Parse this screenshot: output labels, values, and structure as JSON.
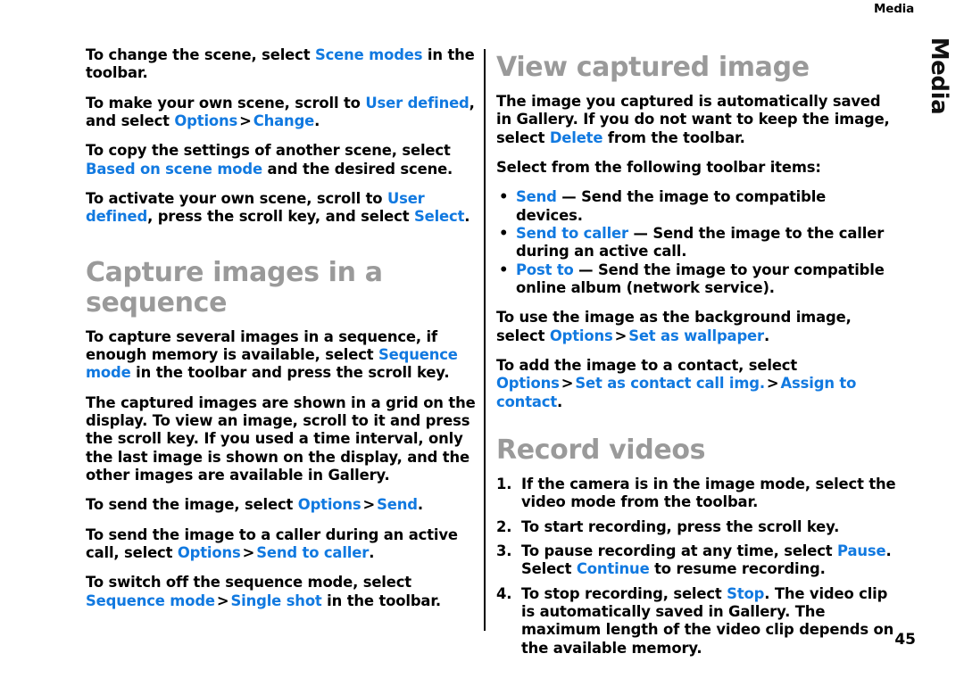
{
  "header": {
    "running_head": "Media",
    "chapter_tab": "Media"
  },
  "footer": {
    "page_number": "45"
  },
  "colors": {
    "ui_accent": "#1179e0",
    "heading_gray": "#9a9a9a",
    "body_text": "#000000",
    "divider": "#000000"
  },
  "left_column": {
    "p1": {
      "t1": "To change the scene, select ",
      "ui1": "Scene modes",
      "t2": " in the toolbar."
    },
    "p2": {
      "t1": "To make your own scene, scroll to ",
      "ui1": "User defined",
      "t2": ", and select ",
      "ui2": "Options",
      "sep": ">",
      "ui3": "Change",
      "t3": "."
    },
    "p3": {
      "t1": "To copy the settings of another scene, select ",
      "ui1": "Based on scene mode",
      "t2": " and the desired scene."
    },
    "p4": {
      "t1": "To activate your own scene, scroll to ",
      "ui1": "User defined",
      "t2": ", press the scroll key, and select ",
      "ui2": "Select",
      "t3": "."
    },
    "heading": "Capture images in a sequence",
    "p5": {
      "t1": "To capture several images in a sequence, if enough memory is available, select ",
      "ui1": "Sequence mode",
      "t2": " in the toolbar and press the scroll key."
    },
    "p6": {
      "t1": "The captured images are shown in a grid on the display. To view an image, scroll to it and press the scroll key. If you used a time interval, only the last image is shown on the display, and the other images are available in Gallery."
    },
    "p7": {
      "t1": "To send the image, select ",
      "ui1": "Options",
      "sep": ">",
      "ui2": "Send",
      "t2": "."
    },
    "p8": {
      "t1": "To send the image to a caller during an active call, select ",
      "ui1": "Options",
      "sep": ">",
      "ui2": "Send to caller",
      "t2": "."
    },
    "p9": {
      "t1": "To switch off the sequence mode, select ",
      "ui1": "Sequence mode",
      "sep": ">",
      "ui2": "Single shot",
      "t2": " in the toolbar."
    }
  },
  "right_column": {
    "heading1": "View captured image",
    "p1": {
      "t1": "The image you captured is automatically saved in Gallery. If you do not want to keep the image, select ",
      "ui1": "Delete",
      "t2": " from the toolbar."
    },
    "p2": {
      "t1": "Select from the following toolbar items:"
    },
    "bullets": [
      {
        "bullet": "•",
        "ui": "Send",
        "dash": " — ",
        "text": "Send the image to compatible devices."
      },
      {
        "bullet": "•",
        "ui": "Send to caller",
        "dash": " — ",
        "text": "Send the image to the caller during an active call."
      },
      {
        "bullet": "•",
        "ui": "Post to",
        "dash": " — ",
        "text": "Send the image to your compatible online album (network service)."
      }
    ],
    "p3": {
      "t1": "To use the image as the background image, select ",
      "ui1": "Options",
      "sep": ">",
      "ui2": "Set as wallpaper",
      "t2": "."
    },
    "p4": {
      "t1": "To add the image to a contact, select ",
      "ui1": "Options",
      "sep1": ">",
      "ui2": "Set as contact call img.",
      "sep2": ">",
      "ui3": "Assign to contact",
      "t2": "."
    },
    "heading2": "Record videos",
    "steps": [
      {
        "num": "1.",
        "t1": "If the camera is in the image mode, select the video mode from the toolbar."
      },
      {
        "num": "2.",
        "t1": "To start recording, press the scroll key."
      },
      {
        "num": "3.",
        "t1": "To pause recording at any time, select ",
        "ui1": "Pause",
        "t2": ". Select ",
        "ui2": "Continue",
        "t3": " to resume recording."
      },
      {
        "num": "4.",
        "t1": "To stop recording, select ",
        "ui1": "Stop",
        "t2": ". The video clip is automatically saved in Gallery. The maximum length of the video clip depends on the available memory."
      }
    ]
  }
}
